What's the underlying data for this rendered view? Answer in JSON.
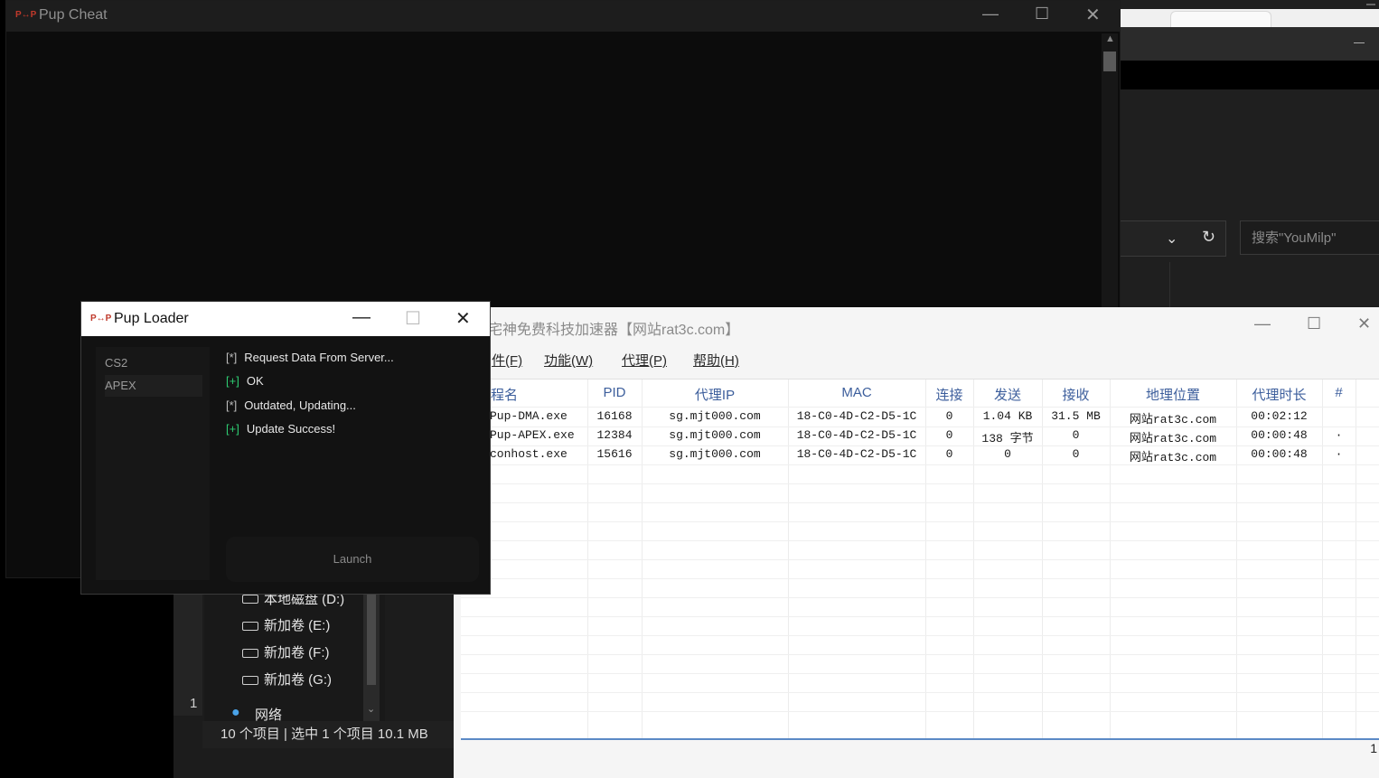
{
  "pup_cheat": {
    "title": "Pup Cheat",
    "logo": "P↔P"
  },
  "bg_right": {
    "search_placeholder": "搜索\"YouMilp\""
  },
  "explorer": {
    "items": [
      "本地磁盘 (D:)",
      "新加卷 (E:)",
      "新加卷 (F:)",
      "新加卷 (G:)"
    ],
    "network": "网络",
    "status": "10 个项目  |  选中 1 个项目  10.1 MB",
    "left_num": "1"
  },
  "loader": {
    "title": "Pup Loader",
    "logo": "P↔P",
    "tabs": [
      "CS2",
      "APEX"
    ],
    "logs": [
      {
        "prefix": "[*]",
        "text": "Request Data From Server..."
      },
      {
        "prefix": "[+]",
        "text": "OK"
      },
      {
        "prefix": "[*]",
        "text": "Outdated, Updating..."
      },
      {
        "prefix": "[+]",
        "text": "Update Success!"
      }
    ],
    "launch": "Launch"
  },
  "accel": {
    "title": "宅神免费科技加速器【网站rat3c.com】",
    "menu": [
      "件(F)",
      "功能(W)",
      "代理(P)",
      "帮助(H)"
    ],
    "columns": [
      "程名",
      "PID",
      "代理IP",
      "MAC",
      "连接",
      "发送",
      "接收",
      "地理位置",
      "代理时长",
      "#"
    ],
    "rows": [
      [
        "Pup-DMA.exe",
        "16168",
        "sg.mjt000.com",
        "18-C0-4D-C2-D5-1C",
        "0",
        "1.04 KB",
        "31.5 MB",
        "网站rat3c.com",
        "00:02:12",
        ""
      ],
      [
        "Pup-APEX.exe",
        "12384",
        "sg.mjt000.com",
        "18-C0-4D-C2-D5-1C",
        "0",
        "138 字节",
        "0",
        "网站rat3c.com",
        "00:00:48",
        "·"
      ],
      [
        "conhost.exe",
        "15616",
        "sg.mjt000.com",
        "18-C0-4D-C2-D5-1C",
        "0",
        "0",
        "0",
        "网站rat3c.com",
        "00:00:48",
        "·"
      ]
    ],
    "page": "1"
  }
}
